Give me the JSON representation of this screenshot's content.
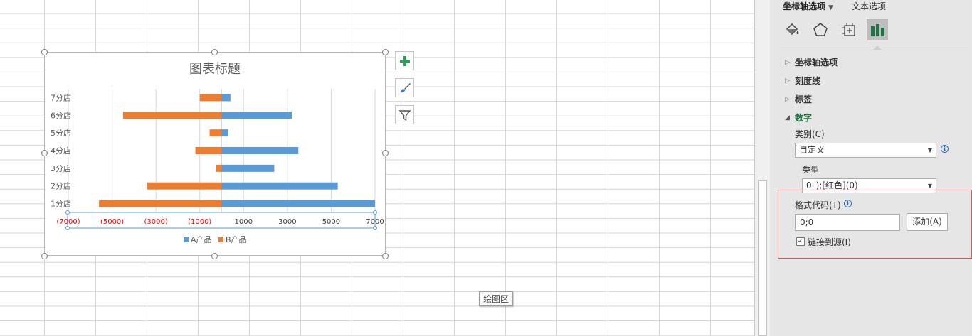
{
  "chart_data": {
    "type": "bar",
    "orientation": "horizontal",
    "title": "图表标题",
    "categories": [
      "1分店",
      "2分店",
      "3分店",
      "4分店",
      "5分店",
      "6分店",
      "7分店"
    ],
    "series": [
      {
        "name": "A产品",
        "color": "#5b9bd5",
        "values": [
          7000,
          5300,
          2400,
          3500,
          300,
          3200,
          400
        ]
      },
      {
        "name": "B产品",
        "color": "#ed7d31",
        "values": [
          -5600,
          -3400,
          -250,
          -1200,
          -550,
          -4500,
          -1000
        ]
      }
    ],
    "x_ticks": [
      {
        "value": -7000,
        "label": "(7000)"
      },
      {
        "value": -5000,
        "label": "(5000)"
      },
      {
        "value": -3000,
        "label": "(3000)"
      },
      {
        "value": -1000,
        "label": "(1000)"
      },
      {
        "value": 1000,
        "label": "1000"
      },
      {
        "value": 3000,
        "label": "3000"
      },
      {
        "value": 5000,
        "label": "5000"
      },
      {
        "value": 7000,
        "label": "7000"
      }
    ],
    "xlim": [
      -7000,
      7000
    ],
    "negative_label_color": "#ff0000",
    "grid": true,
    "legend_position": "bottom"
  },
  "chart_tools": {
    "add_element_icon": "plus-icon",
    "style_icon": "brush-icon",
    "filter_icon": "filter-icon"
  },
  "tooltip": "绘图区",
  "pane": {
    "tab_axis_options": "坐标轴选项",
    "tab_text_options": "文本选项",
    "icons": [
      "fill-icon",
      "pentagon-icon",
      "size-properties-icon",
      "bar-chart-icon"
    ],
    "sections": {
      "axis_options": "坐标轴选项",
      "tick_marks": "刻度线",
      "labels": "标签",
      "number": "数字"
    },
    "category_label": "类别(C)",
    "category_value": "自定义",
    "type_label": "类型",
    "type_value": "0_);[红色](0)",
    "format_code_label": "格式代码(T)",
    "format_code_value": "0;0",
    "add_button": "添加(A)",
    "link_to_source_label": "链接到源(I)",
    "link_to_source_checked": "✓"
  },
  "colors": {
    "accent_green": "#217346",
    "highlight_red": "#e05252"
  }
}
